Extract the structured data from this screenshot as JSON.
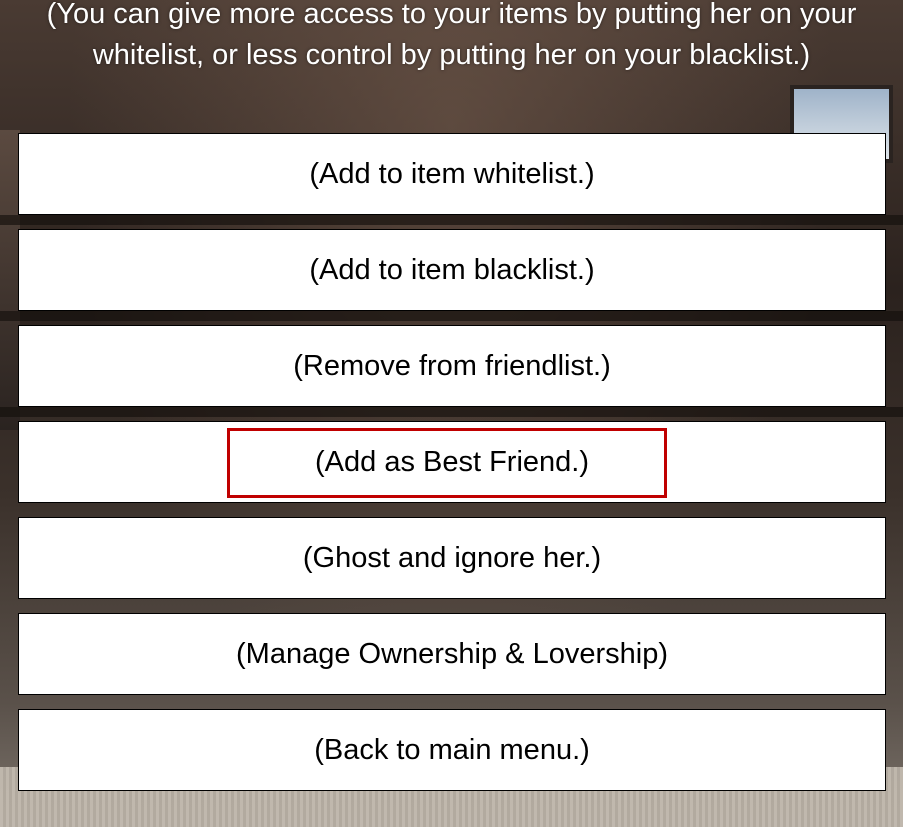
{
  "dialog": {
    "prompt": "(You can give more access to your items by putting her on your whitelist, or less control by putting her on your blacklist.)"
  },
  "menu": {
    "items": [
      {
        "label": "(Add to item whitelist.)"
      },
      {
        "label": "(Add to item blacklist.)"
      },
      {
        "label": "(Remove from friendlist.)"
      },
      {
        "label": "(Add as Best Friend.)",
        "highlighted": true
      },
      {
        "label": "(Ghost and ignore her.)"
      },
      {
        "label": "(Manage Ownership & Lovership)"
      },
      {
        "label": "(Back to main menu.)"
      }
    ]
  },
  "colors": {
    "button_bg": "#ffffff",
    "button_text": "#000000",
    "highlight": "#c00000",
    "prompt_text": "#ffffff"
  }
}
